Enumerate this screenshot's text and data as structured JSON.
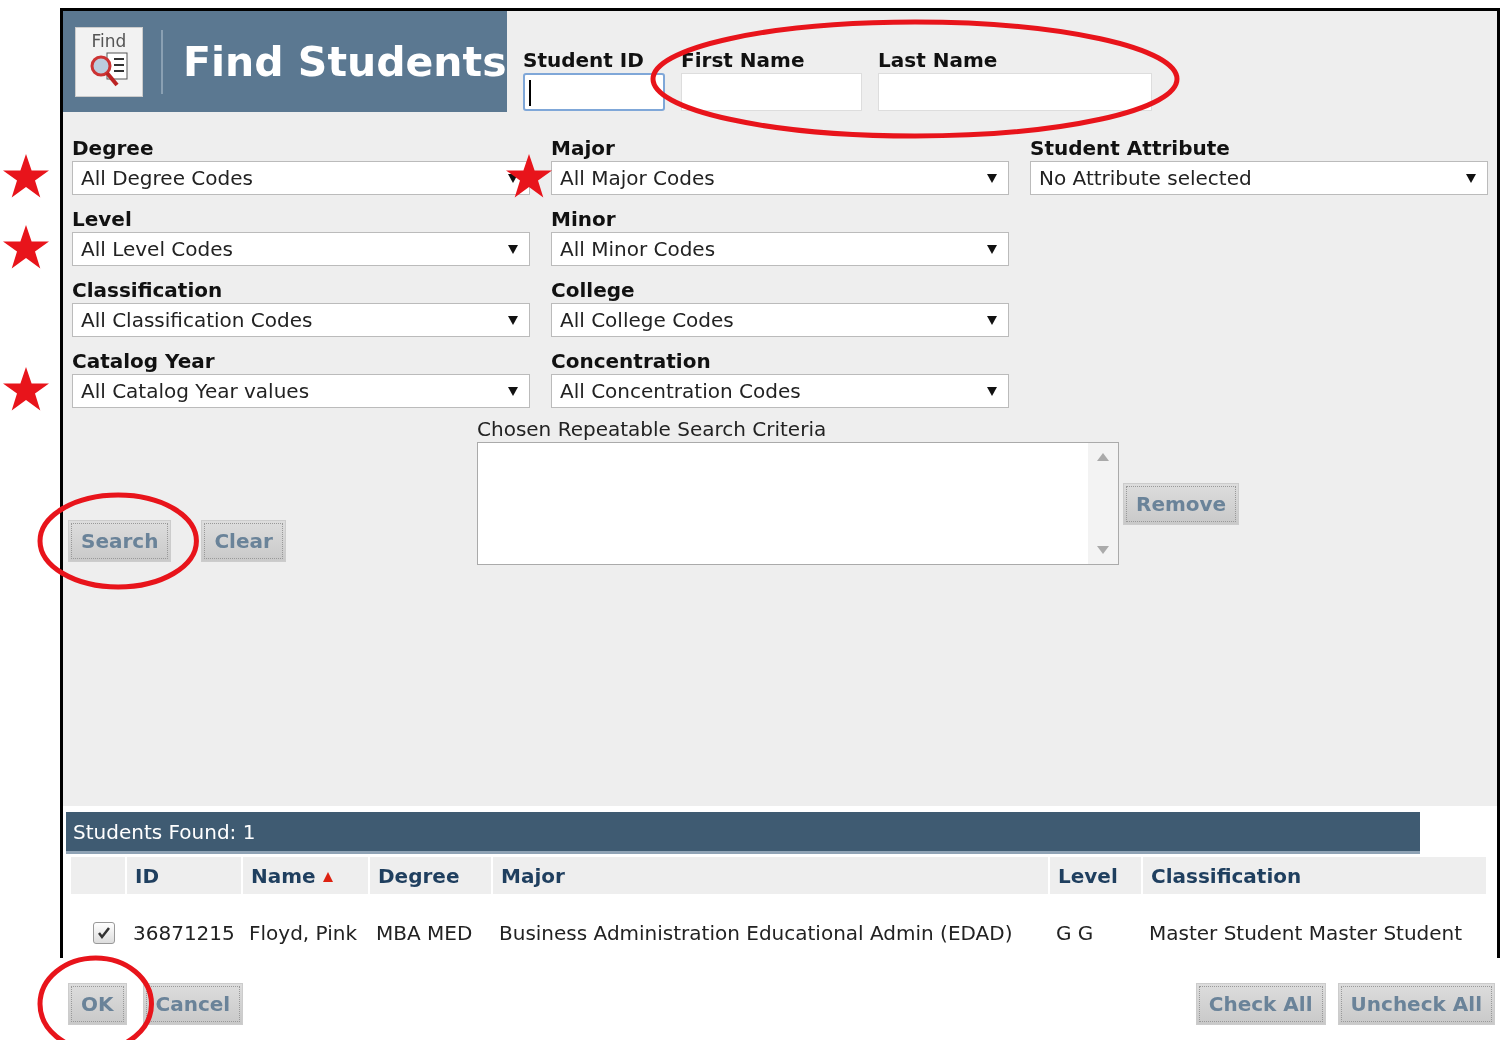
{
  "header": {
    "icon_label": "Find",
    "title": "Find Students"
  },
  "text_fields": [
    {
      "label": "Student ID",
      "focused": true,
      "circled": false
    },
    {
      "label": "First Name",
      "focused": false,
      "circled": true
    },
    {
      "label": "Last Name",
      "focused": false,
      "circled": true
    }
  ],
  "filter_columns": [
    [
      {
        "label": "Degree",
        "value": "All Degree Codes",
        "starred": true
      },
      {
        "label": "Level",
        "value": "All Level Codes",
        "starred": true
      },
      {
        "label": "Classification",
        "value": "All Classification Codes",
        "starred": false
      },
      {
        "label": "Catalog Year",
        "value": "All Catalog Year values",
        "starred": true
      }
    ],
    [
      {
        "label": "Major",
        "value": "All Major Codes",
        "starred": true
      },
      {
        "label": "Minor",
        "value": "All Minor Codes",
        "starred": false
      },
      {
        "label": "College",
        "value": "All College Codes",
        "starred": false
      },
      {
        "label": "Concentration",
        "value": "All Concentration Codes",
        "starred": false
      }
    ],
    [
      {
        "label": "Student Attribute",
        "value": "No Attribute selected",
        "starred": false
      }
    ]
  ],
  "search_buttons": [
    {
      "label": "Search",
      "circled": true
    },
    {
      "label": "Clear",
      "circled": false
    }
  ],
  "criteria": {
    "label": "Chosen Repeatable Search Criteria",
    "button": "Remove"
  },
  "results": {
    "title": "Students Found: 1",
    "columns": [
      {
        "label": "ID",
        "sorted": false
      },
      {
        "label": "Name",
        "sorted": true
      },
      {
        "label": "Degree",
        "sorted": false
      },
      {
        "label": "Major",
        "sorted": false
      },
      {
        "label": "Level",
        "sorted": false
      },
      {
        "label": "Classification",
        "sorted": false
      }
    ],
    "rows": [
      {
        "checked": true,
        "cells": [
          "36871215",
          "Floyd, Pink",
          "MBA MED",
          "Business Administration Educational Admin (EDAD)",
          "G G",
          "Master Student Master Student"
        ]
      }
    ]
  },
  "footer_left": [
    {
      "label": "OK",
      "circled": true
    },
    {
      "label": "Cancel",
      "circled": false
    }
  ],
  "footer_right": [
    {
      "label": "Check All",
      "circled": false
    },
    {
      "label": "Uncheck All",
      "circled": false
    }
  ]
}
